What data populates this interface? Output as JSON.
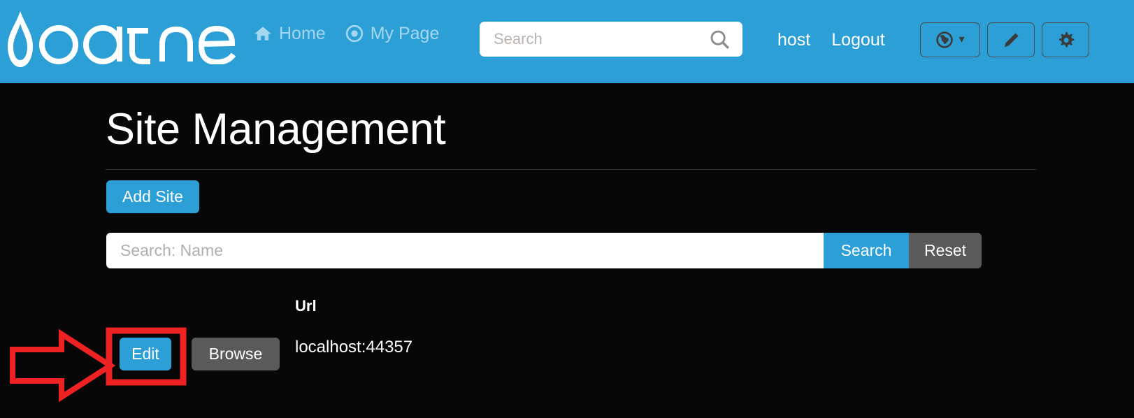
{
  "header": {
    "logo_text": "oqtane",
    "logo_icon": "water-drop-icon",
    "nav": [
      {
        "label": "Home",
        "icon": "home-icon"
      },
      {
        "label": "My Page",
        "icon": "target-icon"
      }
    ],
    "search": {
      "placeholder": "Search",
      "value": "",
      "icon": "search-icon"
    },
    "user": "host",
    "logout_label": "Logout",
    "buttons": [
      {
        "name": "language-selector",
        "icon": "globe-icon",
        "caret": "▾"
      },
      {
        "name": "edit-mode",
        "icon": "pencil-icon"
      },
      {
        "name": "settings",
        "icon": "gear-icon"
      }
    ],
    "background_color": "#2b9fd6",
    "nav_link_color": "#a5d8ef"
  },
  "main": {
    "title": "Site Management",
    "add_site_label": "Add Site",
    "filter": {
      "placeholder": "Search: Name",
      "value": "",
      "search_label": "Search",
      "reset_label": "Reset"
    },
    "table": {
      "columns": [
        "",
        "",
        "Url"
      ],
      "url_header": "Url",
      "rows": [
        {
          "edit_label": "Edit",
          "browse_label": "Browse",
          "url": "localhost:44357"
        }
      ]
    }
  },
  "annotation": {
    "type": "red-arrow-and-box",
    "target": "edit-button",
    "color": "#ee2222"
  },
  "colors": {
    "accent": "#2b9fd6",
    "secondary": "#5a5a5a",
    "background": "#070707",
    "annotation": "#ee2222",
    "text": "#ffffff"
  }
}
